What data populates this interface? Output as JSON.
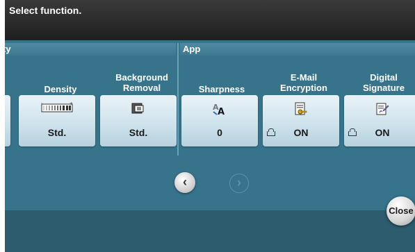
{
  "prompt": "Select function.",
  "sections": {
    "left_title": "ty",
    "right_title": "App"
  },
  "functions": [
    {
      "label": "Density",
      "value": "Std.",
      "icon": "density-icon"
    },
    {
      "label": "Background Removal",
      "value": "Std.",
      "icon": "background-removal-icon"
    },
    {
      "label": "Sharpness",
      "value": "0",
      "icon": "sharpness-icon"
    },
    {
      "label": "E-Mail Encryption",
      "value": "ON",
      "icon": "email-encryption-icon"
    },
    {
      "label": "Digital Signature",
      "value": "ON",
      "icon": "digital-signature-icon"
    }
  ],
  "labels": {
    "density": "Density",
    "bg_line1": "Background",
    "bg_line2": "Removal",
    "sharpness": "Sharpness",
    "email_line1": "E-Mail",
    "email_line2": "Encryption",
    "sig_line1": "Digital",
    "sig_line2": "Signature"
  },
  "values": {
    "density": "Std.",
    "background_removal": "Std.",
    "sharpness": "0",
    "email_encryption": "ON",
    "digital_signature": "ON"
  },
  "nav": {
    "prev": "‹",
    "next": "›"
  },
  "close_label": "Close"
}
